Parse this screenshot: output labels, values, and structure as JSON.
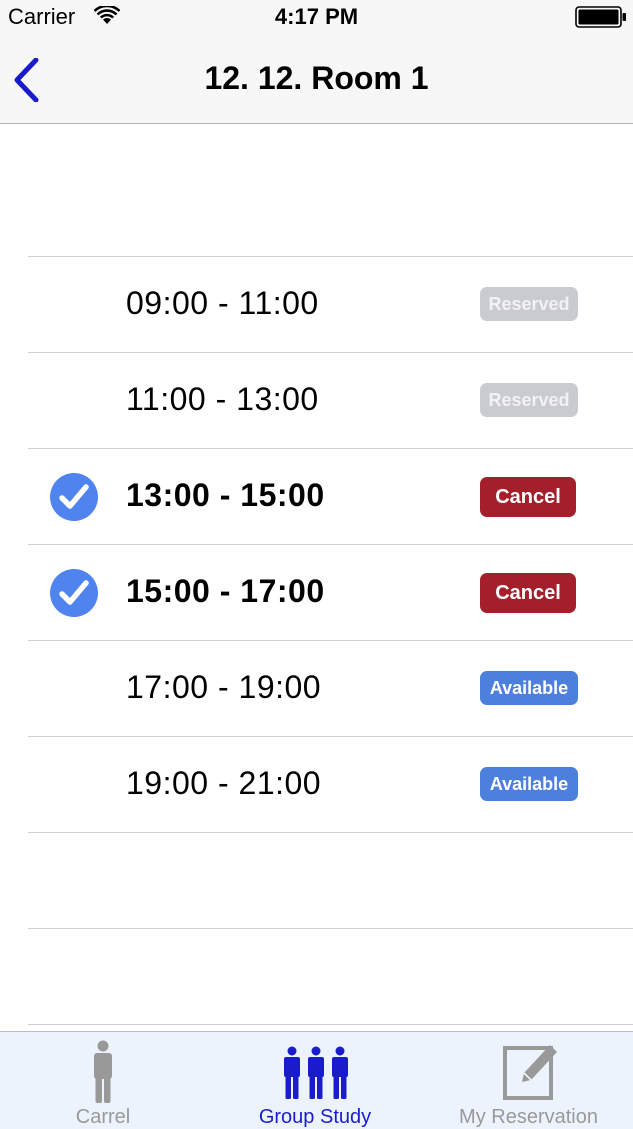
{
  "status_bar": {
    "carrier": "Carrier",
    "time": "4:17 PM"
  },
  "nav": {
    "title": "12. 12. Room 1",
    "back_icon": "chevron-left-icon",
    "accent_color": "#1a1ccc"
  },
  "slots": [
    {
      "time": "09:00 - 11:00",
      "status": "reserved",
      "button_label": "Reserved",
      "checked": false
    },
    {
      "time": "11:00 - 13:00",
      "status": "reserved",
      "button_label": "Reserved",
      "checked": false
    },
    {
      "time": "13:00 - 15:00",
      "status": "mine",
      "button_label": "Cancel",
      "checked": true
    },
    {
      "time": "15:00 - 17:00",
      "status": "mine",
      "button_label": "Cancel",
      "checked": true
    },
    {
      "time": "17:00 - 19:00",
      "status": "available",
      "button_label": "Available",
      "checked": false
    },
    {
      "time": "19:00 - 21:00",
      "status": "available",
      "button_label": "Available",
      "checked": false
    }
  ],
  "colors": {
    "reserved": "#c9cbd1",
    "cancel": "#a51f2b",
    "available": "#4d80dd",
    "check": "#4f84ee",
    "tab_active": "#1a1ccc",
    "tab_inactive": "#999999"
  },
  "tabs": [
    {
      "label": "Carrel",
      "icon": "person-icon",
      "active": false
    },
    {
      "label": "Group Study",
      "icon": "group-icon",
      "active": true
    },
    {
      "label": "My Reservation",
      "icon": "edit-icon",
      "active": false
    }
  ]
}
